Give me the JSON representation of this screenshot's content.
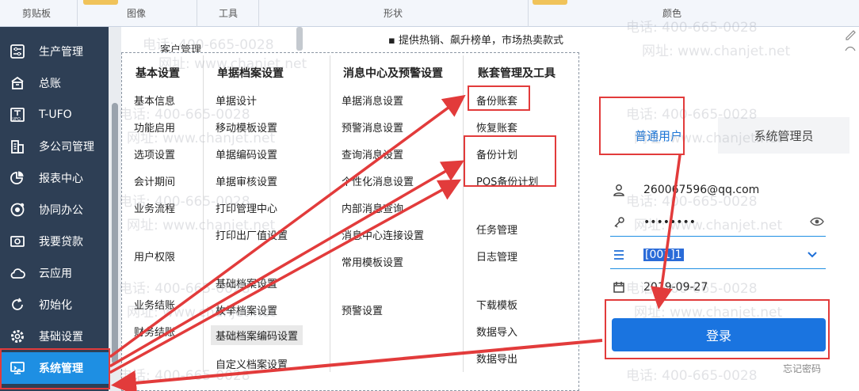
{
  "ribbon": {
    "groups": [
      "剪贴板",
      "图像",
      "工具",
      "形状",
      "颜色"
    ]
  },
  "sidebar": {
    "items": [
      {
        "label": "生产管理",
        "icon": "production-icon"
      },
      {
        "label": "总账",
        "icon": "ledger-icon"
      },
      {
        "label": "T-UFO",
        "icon": "tufo-icon"
      },
      {
        "label": "多公司管理",
        "icon": "multi-company-icon"
      },
      {
        "label": "报表中心",
        "icon": "report-pie-icon"
      },
      {
        "label": "协同办公",
        "icon": "collab-icon"
      },
      {
        "label": "我要贷款",
        "icon": "loan-icon"
      },
      {
        "label": "云应用",
        "icon": "cloud-icon"
      },
      {
        "label": "初始化",
        "icon": "refresh-icon"
      },
      {
        "label": "基础设置",
        "icon": "gear-icon"
      },
      {
        "label": "系统管理",
        "icon": "monitor-icon"
      }
    ],
    "active_index": 10
  },
  "top": {
    "customer": "客户管理",
    "bullet": "提供热销、飙升榜单，市场热卖款式"
  },
  "menu": {
    "columns": [
      {
        "header": "基本设置",
        "items": [
          "基本信息",
          "功能启用",
          "选项设置",
          "会计期间",
          "业务流程",
          "用户权限",
          "业务结账",
          "财务结账"
        ]
      },
      {
        "header": "单据档案设置",
        "items": [
          "单据设计",
          "移动模板设置",
          "单据编码设置",
          "单据审核设置",
          "打印管理中心",
          "打印出厂值设置",
          "基础档案设置",
          "枚举档案设置",
          "基础档案编码设置",
          "自定义档案设置"
        ]
      },
      {
        "header": "消息中心及预警设置",
        "items": [
          "单据消息设置",
          "预警消息设置",
          "查询消息设置",
          "个性化消息设置",
          "内部消息查询",
          "消息中心连接设置",
          "常用模板设置",
          "预警设置"
        ]
      },
      {
        "header": "账套管理及工具",
        "items": [
          "备份账套",
          "恢复账套",
          "备份计划",
          "POS备份计划",
          "任务管理",
          "日志管理",
          "下载模板",
          "数据导入",
          "数据导出"
        ]
      }
    ]
  },
  "login": {
    "tabs": [
      "普通用户",
      "系统管理员"
    ],
    "username": "260067596@qq.com",
    "password": "••••••••",
    "account": "[001]1",
    "date": "2019-09-27",
    "login_button": "登录",
    "forgot": "忘记密码"
  },
  "watermark": {
    "phone": "电话: 400-665-0028",
    "site": "网址: www.chanjet.net"
  },
  "colors": {
    "sidebar_bg": "#2e3f55",
    "active": "#1e8fe3",
    "annotation": "#e23b3b",
    "primary_button": "#1a74e0"
  }
}
